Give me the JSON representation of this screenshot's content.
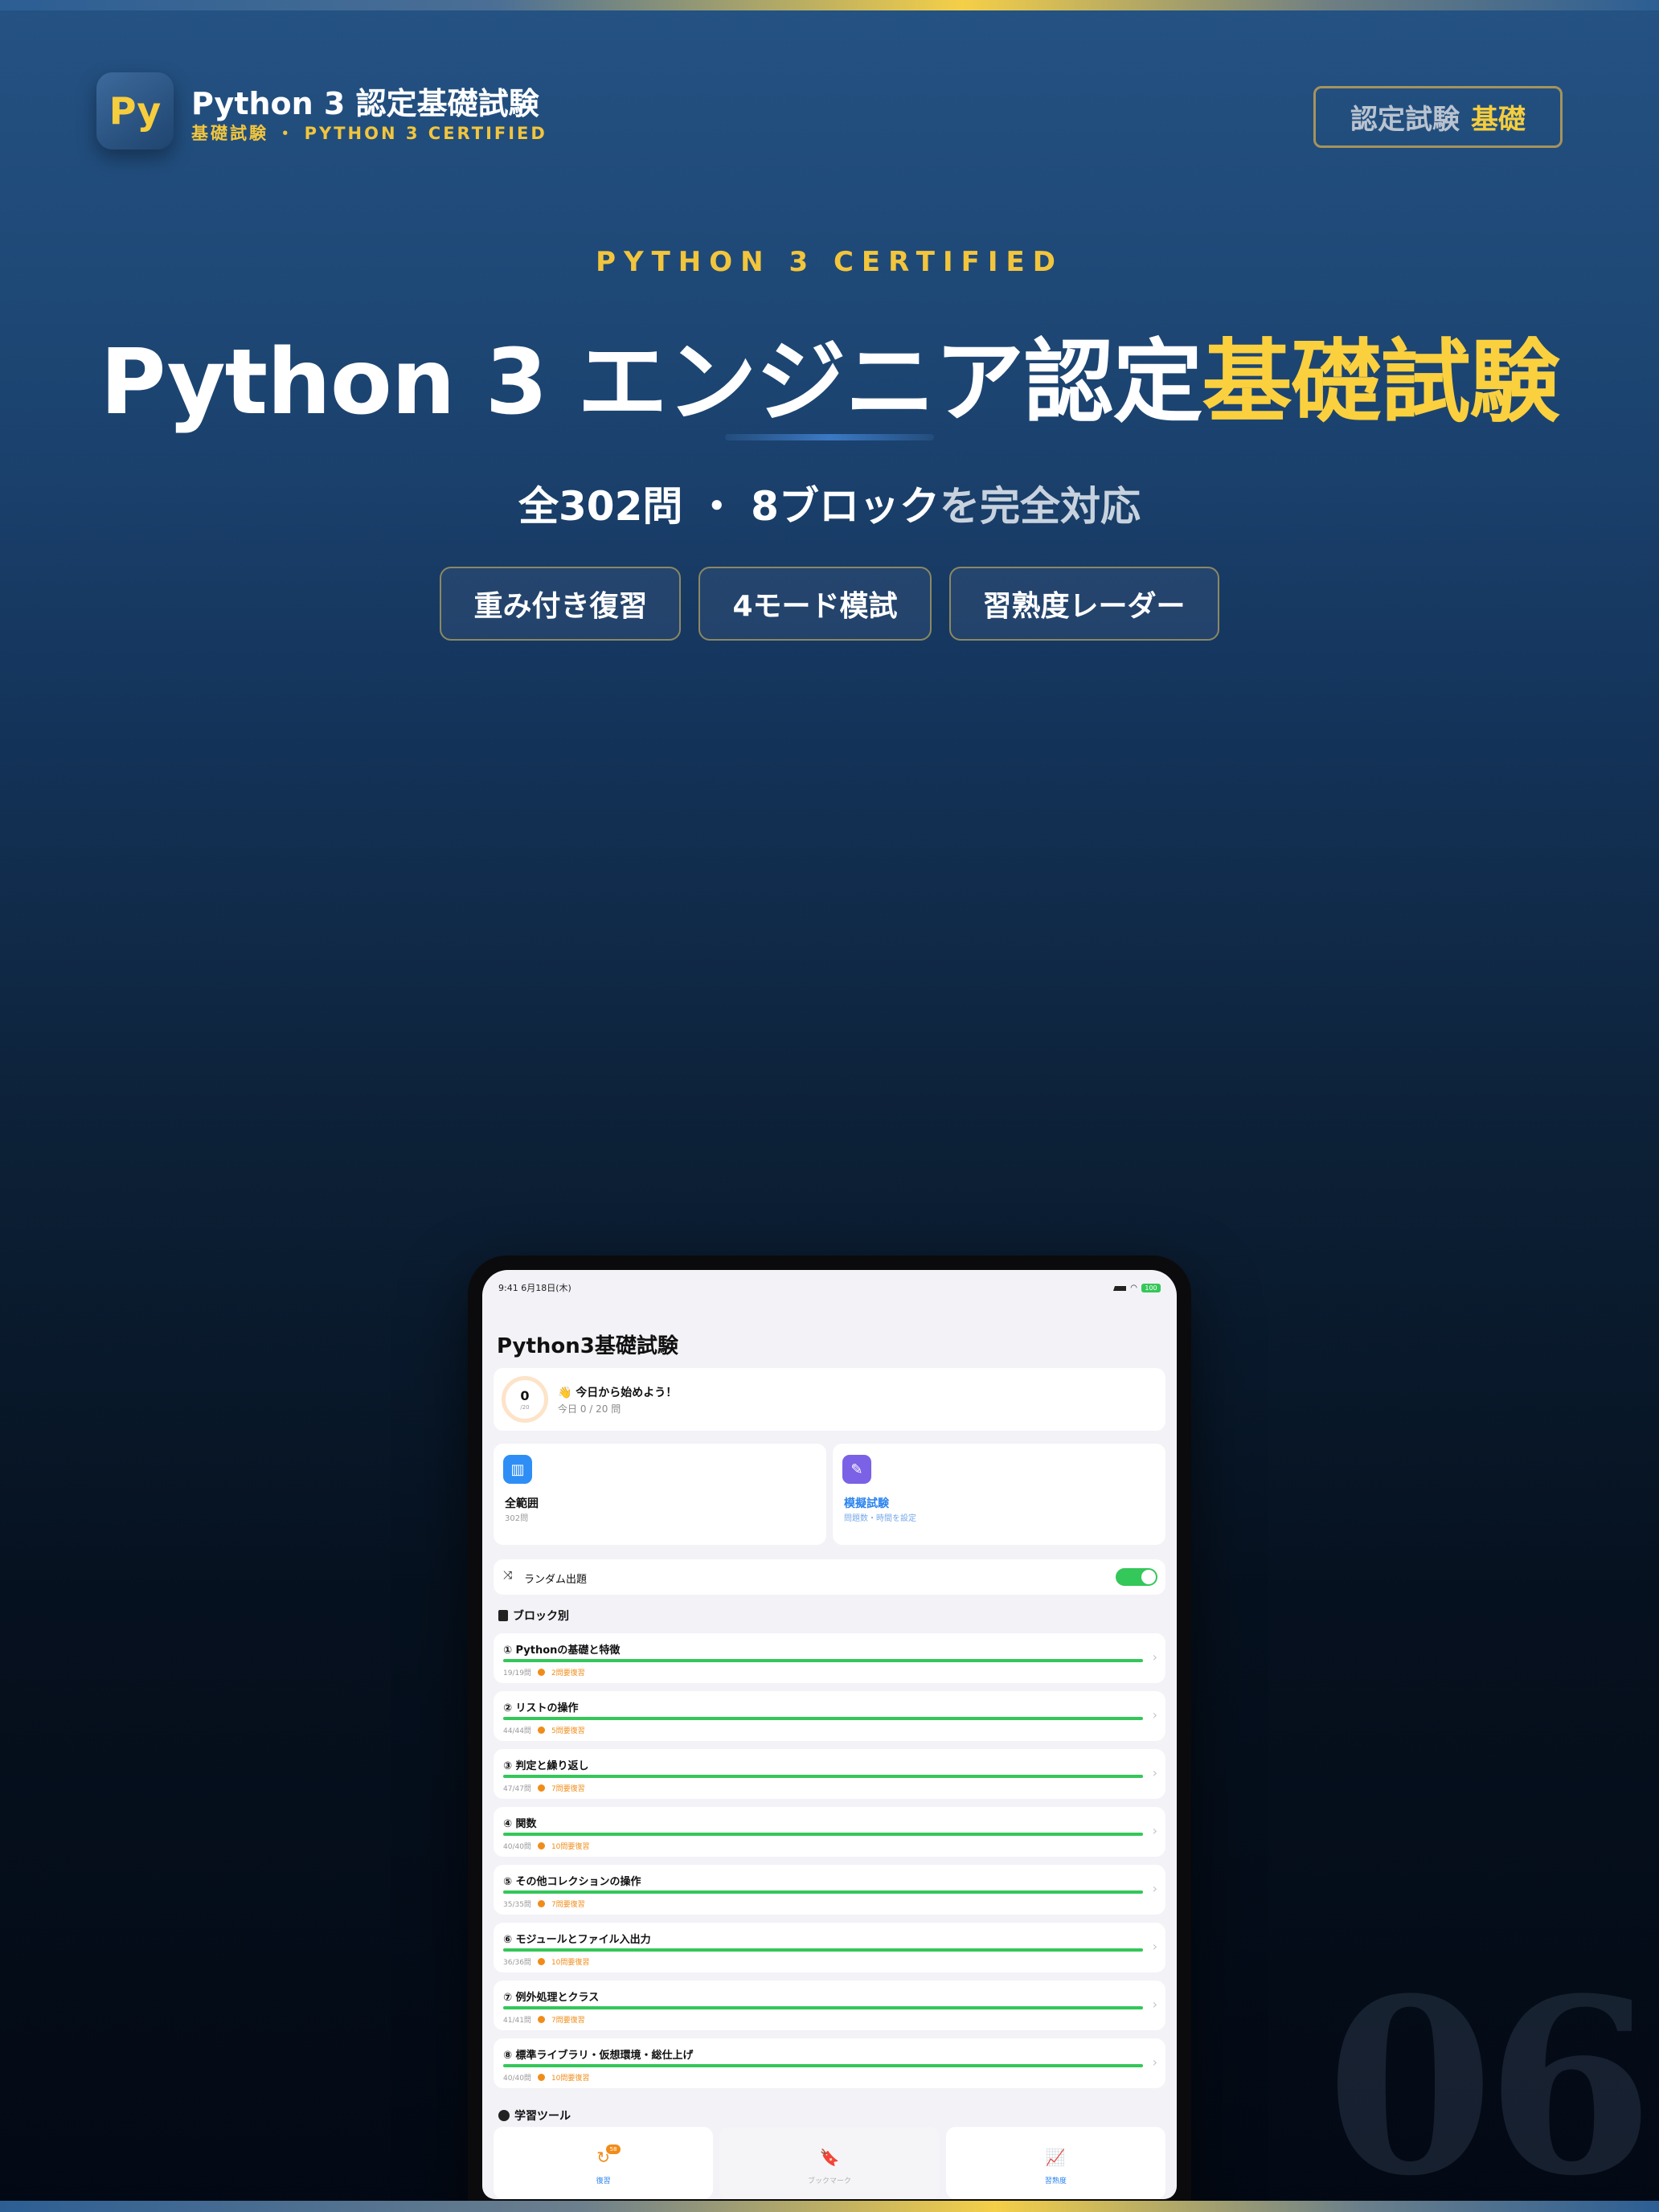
{
  "header": {
    "logo_text": "Py",
    "brand_title": "Python 3 認定基礎試験",
    "brand_sub": "基礎試験 ・ PYTHON 3 CERTIFIED",
    "badge_part1": "認定試験",
    "badge_part2": "基礎"
  },
  "hero": {
    "eyebrow": "PYTHON 3 CERTIFIED",
    "headline_white": "Python 3 エンジニア認定",
    "headline_yellow": "基礎試験",
    "subline_white": "全302問 ・ 8ブロック",
    "subline_gray": "を完全対応",
    "pills": [
      "重み付き復習",
      "4モード模試",
      "習熟度レーダー"
    ]
  },
  "page_number": "06",
  "device": {
    "status_time": "9:41 6月18日(木)",
    "battery": "100",
    "app_title": "Python3基礎試験",
    "today": {
      "count": "0",
      "goal": "/20",
      "headline": "👋 今日から始めよう！",
      "progress": "今日 0 / 20 問"
    },
    "modes": [
      {
        "icon": "bar-chart-icon",
        "glyph": "▥",
        "label": "全範囲",
        "sub": "302問"
      },
      {
        "icon": "clipboard-icon",
        "glyph": "✎",
        "label": "模擬試験",
        "sub": "問題数・時間を設定"
      }
    ],
    "random": {
      "icon": "shuffle-icon",
      "glyph": "⤨",
      "label": "ランダム出題",
      "on": true
    },
    "blocks_section": "ブロック別",
    "blocks": [
      {
        "name": "① Pythonの基礎と特徴",
        "count": "19/19問",
        "review": "2問要復習",
        "progress": 1.0
      },
      {
        "name": "② リストの操作",
        "count": "44/44問",
        "review": "5問要復習",
        "progress": 1.0
      },
      {
        "name": "③ 判定と繰り返し",
        "count": "47/47問",
        "review": "7問要復習",
        "progress": 1.0
      },
      {
        "name": "④ 関数",
        "count": "40/40問",
        "review": "10問要復習",
        "progress": 1.0
      },
      {
        "name": "⑤ その他コレクションの操作",
        "count": "35/35問",
        "review": "7問要復習",
        "progress": 1.0
      },
      {
        "name": "⑥ モジュールとファイル入出力",
        "count": "36/36問",
        "review": "10問要復習",
        "progress": 1.0
      },
      {
        "name": "⑦ 例外処理とクラス",
        "count": "41/41問",
        "review": "7問要復習",
        "progress": 1.0
      },
      {
        "name": "⑧ 標準ライブラリ・仮想環境・総仕上げ",
        "count": "40/40問",
        "review": "10問要復習",
        "progress": 1.0
      }
    ],
    "tools_section": "学習ツール",
    "tools": [
      {
        "icon": "review-icon",
        "glyph": "↻",
        "label": "復習",
        "badge": "58"
      },
      {
        "icon": "bookmark-icon",
        "glyph": "🔖",
        "label": "ブックマーク"
      },
      {
        "icon": "trend-chart-icon",
        "glyph": "📈",
        "label": "習熟度"
      }
    ]
  },
  "colors": {
    "accent_yellow": "#fbd03e",
    "navy": "#1c4471",
    "progress_green": "#34c759",
    "warning_orange": "#f08c1a",
    "link_blue": "#2a84ee"
  }
}
